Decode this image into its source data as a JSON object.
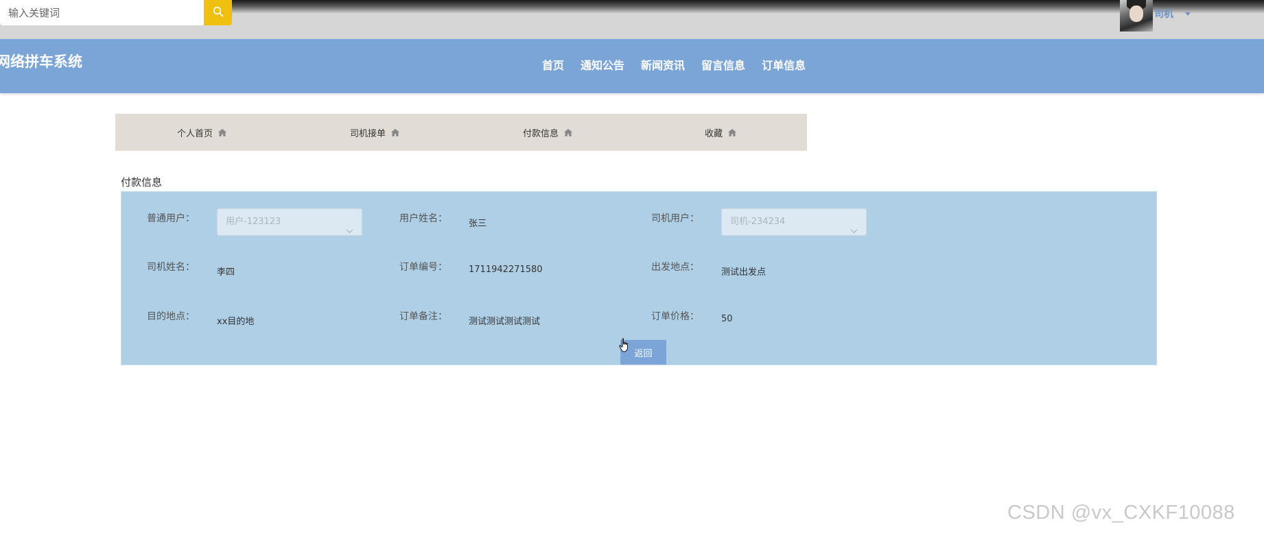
{
  "header": {
    "search_placeholder": "输入关键词",
    "user_name": "司机"
  },
  "navbar": {
    "site_title": "网络拼车系统",
    "menu": [
      "首页",
      "通知公告",
      "新闻资讯",
      "留言信息",
      "订单信息"
    ]
  },
  "sub_tabs": [
    "个人首页",
    "司机接单",
    "付款信息",
    "收藏"
  ],
  "section_title": "付款信息",
  "form": {
    "normal_user_label": "普通用户：",
    "normal_user_value": "用户-123123",
    "user_name_label": "用户姓名：",
    "user_name_value": "张三",
    "driver_user_label": "司机用户：",
    "driver_user_value": "司机-234234",
    "driver_name_label": "司机姓名：",
    "driver_name_value": "李四",
    "order_no_label": "订单编号：",
    "order_no_value": "1711942271580",
    "departure_label": "出发地点：",
    "departure_value": "测试出发点",
    "destination_label": "目的地点：",
    "destination_value": "xx目的地",
    "remark_label": "订单备注：",
    "remark_value": "测试测试测试测试",
    "price_label": "订单价格：",
    "price_value": "50",
    "back_button": "返回"
  },
  "watermark": "CSDN @vx_CXKF10088",
  "colors": {
    "navbar": "#7ba5d7",
    "search_button": "#f0c010",
    "panel": "#aecfe5",
    "sub_tabs_bg": "#e2dcd6"
  }
}
